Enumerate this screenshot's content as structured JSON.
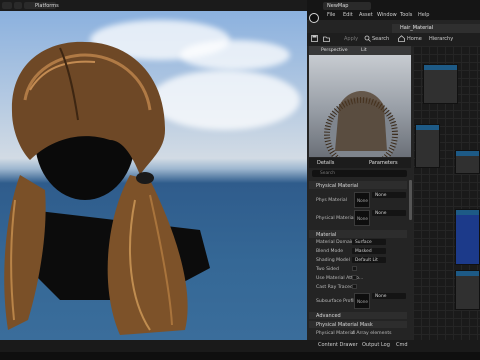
{
  "viewport": {
    "platforms_label": "Platforms"
  },
  "title_bar": {
    "main_tab": "NewMap"
  },
  "menu": [
    "File",
    "Edit",
    "Asset",
    "Window",
    "Tools",
    "Help"
  ],
  "asset_tab": {
    "label": "Hair_Material"
  },
  "toolbar": {
    "apply_label": "Apply",
    "search_label": "Search",
    "home_label": "Home",
    "hierarchy_label": "Hierarchy"
  },
  "preview": {
    "perspective_label": "Perspective",
    "lit_label": "Lit"
  },
  "details_panel": {
    "details_tab": "Details",
    "parameters_tab": "Parameters",
    "search_placeholder": "Search"
  },
  "sections": {
    "physical_material": "Physical Material",
    "material": "Material",
    "advanced": "Advanced",
    "physical_material_mask": "Physical Material Mask"
  },
  "properties": {
    "phys_material": "Phys Material",
    "phys_material_map": "Physical Material Ma...",
    "material_domain": "Material Domain",
    "blend_mode": "Blend Mode",
    "shading_model": "Shading Model",
    "two_sided": "Two Sided",
    "use_material_attr": "Use Material Attrib...",
    "cast_ray_traced": "Cast Ray Traced...",
    "subsurface_profile": "Subsurface Profile",
    "physical_material_bottom": "Physical Material"
  },
  "values": {
    "none": "None",
    "surface": "Surface",
    "masked": "Masked",
    "default_lit": "Default Lit",
    "elements_count": "4 Array elements"
  },
  "status_bar": {
    "content_drawer": "Content Drawer",
    "output_log": "Output Log",
    "cmd": "Cmd"
  },
  "colors": {
    "node_header": "#1d5a86",
    "accent": "#2a6db0"
  }
}
